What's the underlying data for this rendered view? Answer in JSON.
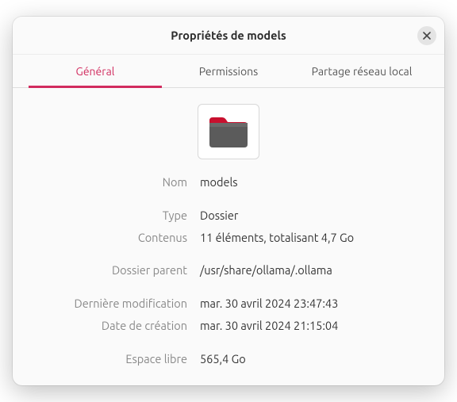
{
  "window": {
    "title": "Propriétés de models"
  },
  "tabs": {
    "general": "Général",
    "permissions": "Permissions",
    "local_share": "Partage réseau local"
  },
  "labels": {
    "name": "Nom",
    "type": "Type",
    "contents": "Contenus",
    "parent": "Dossier parent",
    "modified": "Dernière modification",
    "created": "Date de création",
    "free": "Espace libre"
  },
  "values": {
    "name": "models",
    "type": "Dossier",
    "contents": "11 éléments, totalisant 4,7 Go",
    "parent": "/usr/share/ollama/.ollama",
    "modified": "mar. 30 avril 2024 23:47:43",
    "created": "mar. 30 avril 2024 21:15:04",
    "free": "565,4 Go"
  }
}
